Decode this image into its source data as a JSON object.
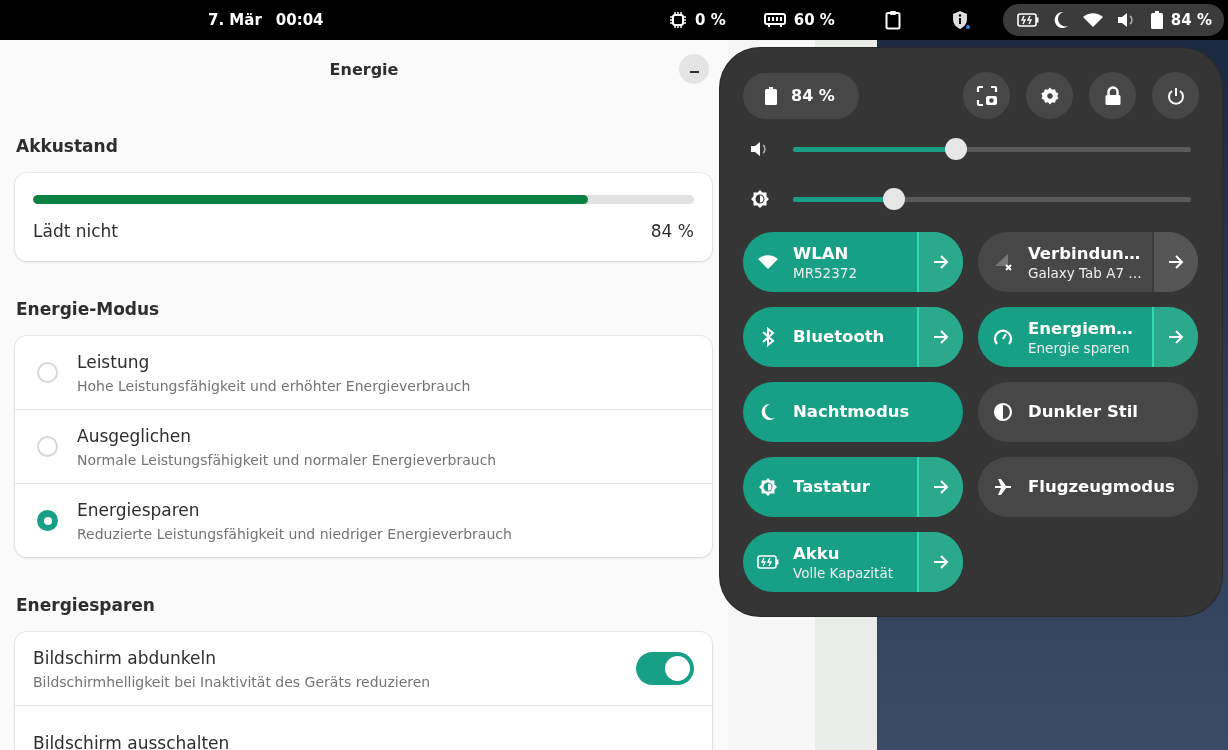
{
  "top_bar": {
    "date": "7. Mär",
    "time": "00:04",
    "indicators": [
      {
        "value": "0 %"
      },
      {
        "value": "60 %"
      }
    ],
    "status_percent": "84 %"
  },
  "window": {
    "title": "Energie"
  },
  "battery": {
    "heading": "Akkustand",
    "level": 0.84,
    "status": "Lädt nicht",
    "percent": "84 %"
  },
  "power_mode": {
    "heading": "Energie-Modus",
    "options": [
      {
        "title": "Leistung",
        "subtitle": "Hohe Leistungsfähigkeit und erhöhter Energieverbrauch",
        "selected": false
      },
      {
        "title": "Ausgeglichen",
        "subtitle": "Normale Leistungsfähigkeit und normaler Energieverbrauch",
        "selected": false
      },
      {
        "title": "Energiesparen",
        "subtitle": "Reduzierte Leistungsfähigkeit und niedriger Energieverbrauch",
        "selected": true
      }
    ]
  },
  "power_saving": {
    "heading": "Energiesparen",
    "rows": [
      {
        "kind": "switch",
        "title": "Bildschirm abdunkeln",
        "subtitle": "Bildschirmhelligkeit bei Inaktivität des Geräts reduzieren",
        "on": true
      },
      {
        "kind": "label",
        "title": "Bildschirm ausschalten"
      }
    ]
  },
  "quick_settings": {
    "battery_percent": "84 %",
    "sliders": [
      {
        "kind": "volume",
        "level": 0.41
      },
      {
        "kind": "brightness",
        "level": 0.255
      }
    ],
    "tiles": [
      {
        "title": "WLAN",
        "subtitle": "MR52372",
        "active": true,
        "menu": true
      },
      {
        "title": "Verbindun…",
        "subtitle": "Galaxy Tab A7 …",
        "active": false,
        "menu": true
      },
      {
        "title": "Bluetooth",
        "active": true,
        "menu": true
      },
      {
        "title": "Energiem…",
        "subtitle": "Energie sparen",
        "active": true,
        "menu": true
      },
      {
        "title": "Nachtmodus",
        "active": true,
        "menu": false
      },
      {
        "title": "Dunkler Stil",
        "active": false,
        "menu": false
      },
      {
        "title": "Tastatur",
        "active": true,
        "menu": true
      },
      {
        "title": "Flugzeugmodus",
        "active": false,
        "menu": false
      },
      {
        "title": "Akku",
        "subtitle": "Volle Kapazität",
        "active": true,
        "menu": true
      }
    ]
  }
}
